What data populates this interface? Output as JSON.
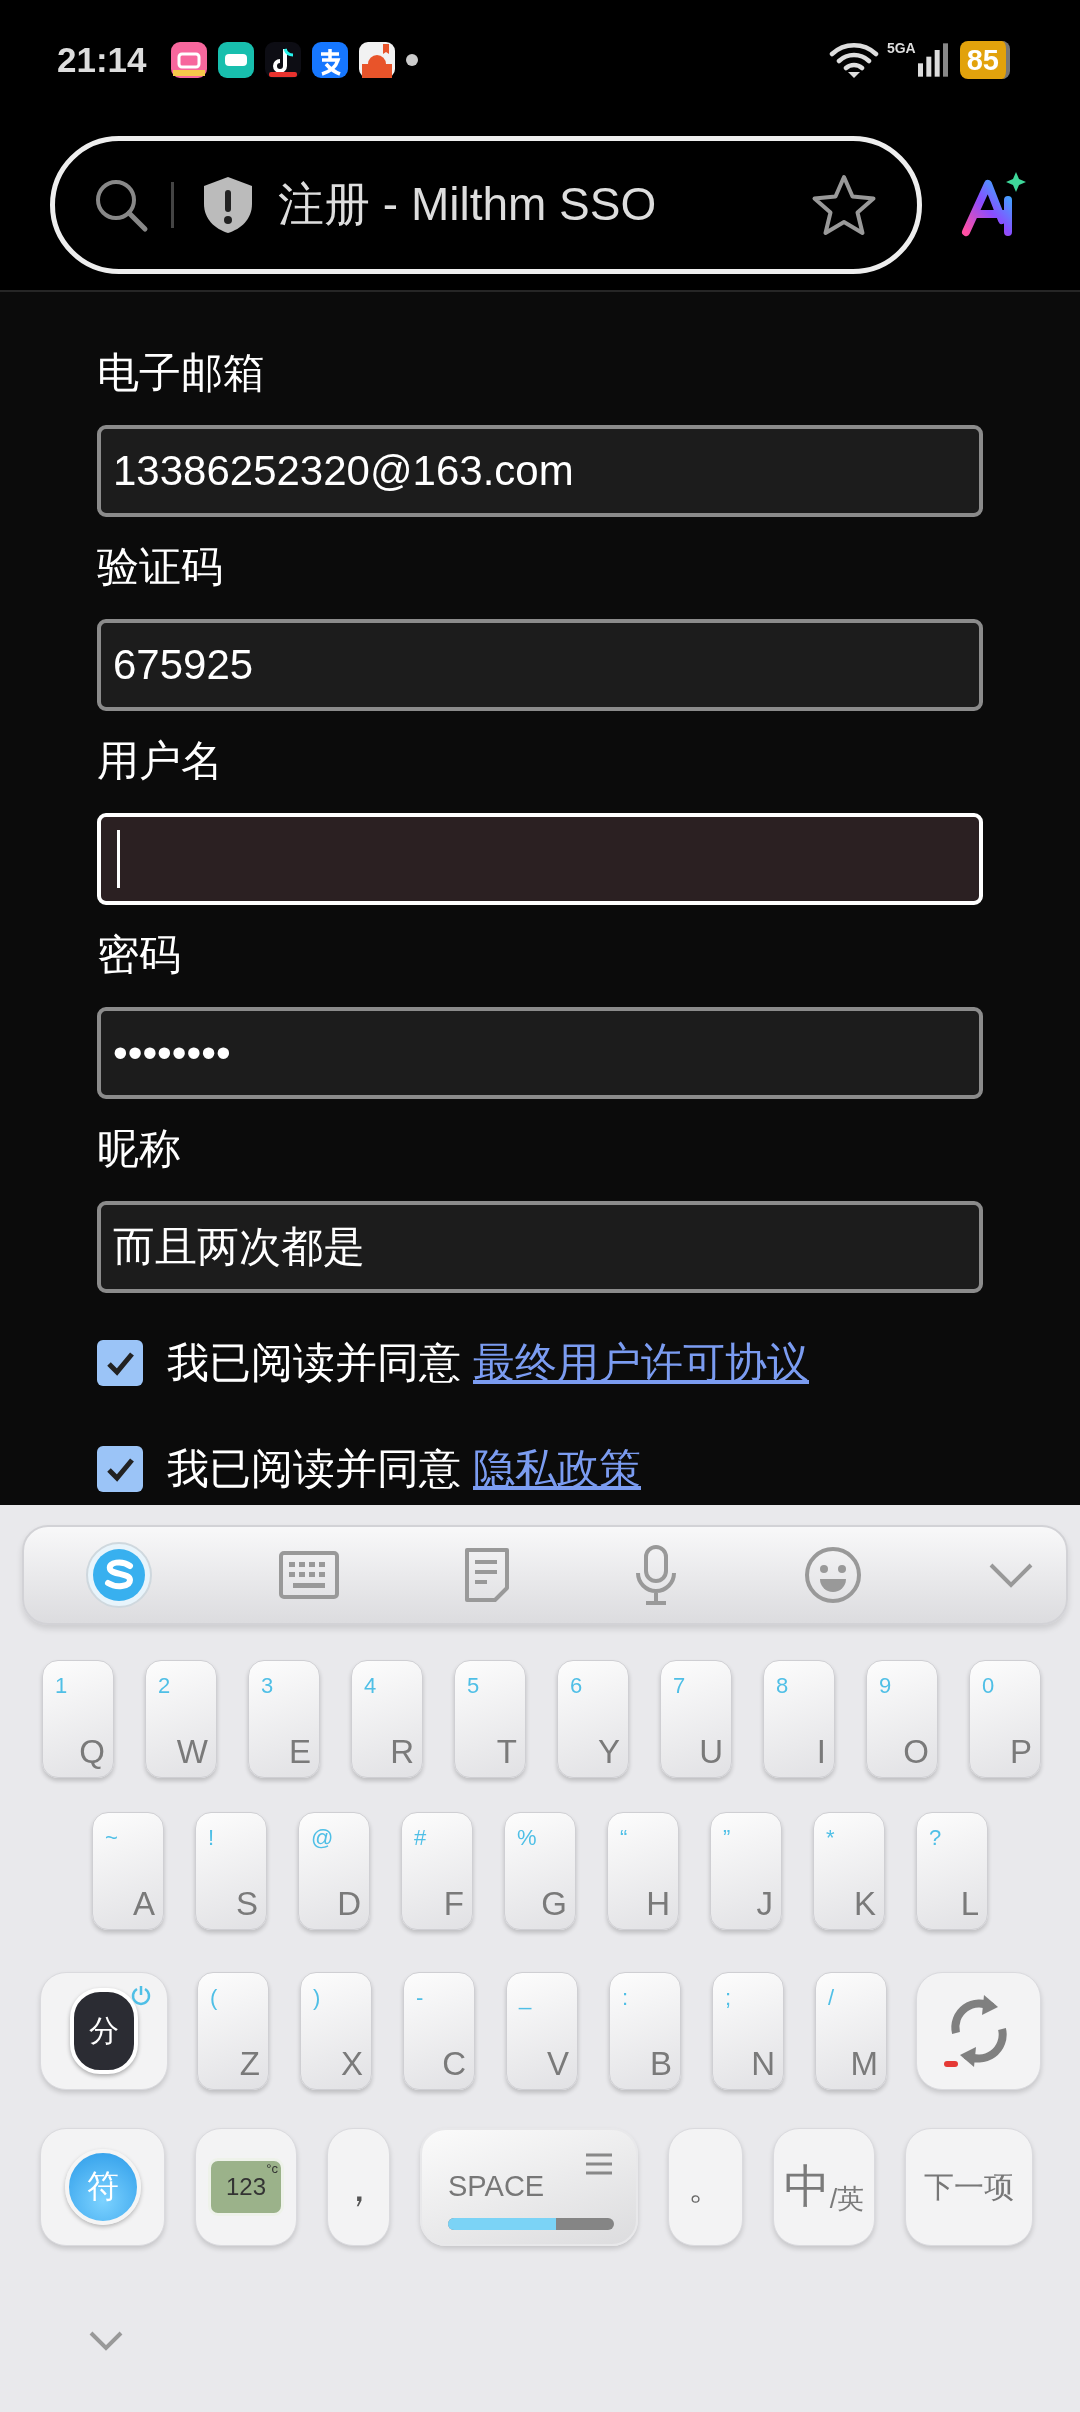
{
  "status_bar": {
    "time": "21:14",
    "network": "5GA",
    "battery": "85"
  },
  "address_bar": {
    "title": "注册 - Milthm SSO"
  },
  "form": {
    "fields": [
      {
        "label": "电子邮箱",
        "value": "13386252320@163.com",
        "focused": false
      },
      {
        "label": "验证码",
        "value": "675925",
        "focused": false
      },
      {
        "label": "用户名",
        "focused": true
      },
      {
        "label": "密码",
        "value": "••••••••",
        "focused": false
      },
      {
        "label": "昵称",
        "value": "而且两次都是",
        "focused": false
      }
    ],
    "agreements": [
      {
        "text": "我已阅读并同意",
        "link": "最终用户许可协议",
        "checked": true
      },
      {
        "text": "我已阅读并同意",
        "link": "隐私政策",
        "checked": true
      }
    ]
  },
  "keyboard": {
    "letter_rows": [
      [
        {
          "key": "Q",
          "alt": "1"
        },
        {
          "key": "W",
          "alt": "2"
        },
        {
          "key": "E",
          "alt": "3"
        },
        {
          "key": "R",
          "alt": "4"
        },
        {
          "key": "T",
          "alt": "5"
        },
        {
          "key": "Y",
          "alt": "6"
        },
        {
          "key": "U",
          "alt": "7"
        },
        {
          "key": "I",
          "alt": "8"
        },
        {
          "key": "O",
          "alt": "9"
        },
        {
          "key": "P",
          "alt": "0"
        }
      ],
      [
        {
          "key": "A",
          "alt": "~"
        },
        {
          "key": "S",
          "alt": "!"
        },
        {
          "key": "D",
          "alt": "@"
        },
        {
          "key": "F",
          "alt": "#"
        },
        {
          "key": "G",
          "alt": "%"
        },
        {
          "key": "H",
          "alt": "“"
        },
        {
          "key": "J",
          "alt": "”"
        },
        {
          "key": "K",
          "alt": "*"
        },
        {
          "key": "L",
          "alt": "?"
        }
      ],
      [
        {
          "key": "Z",
          "alt": "("
        },
        {
          "key": "X",
          "alt": ")"
        },
        {
          "key": "C",
          "alt": "-"
        },
        {
          "key": "V",
          "alt": "_"
        },
        {
          "key": "B",
          "alt": ":"
        },
        {
          "key": "N",
          "alt": ";"
        },
        {
          "key": "M",
          "alt": "/"
        }
      ]
    ],
    "segment_key": "分",
    "symbol_key": "符",
    "number_key": {
      "label": "123",
      "unit": "°c"
    },
    "comma_key": "，",
    "space_key": {
      "label": "SPACE",
      "level": 0.65
    },
    "period_key": "。",
    "language_key": {
      "label": "中",
      "sub": "/英"
    },
    "next_key": "下一项"
  }
}
